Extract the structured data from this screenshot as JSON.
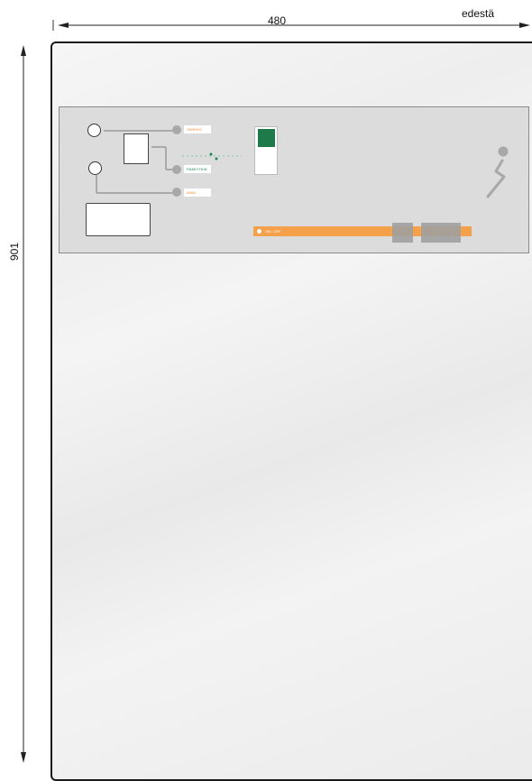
{
  "dimensions": {
    "width_label": "480",
    "height_label": "901",
    "view_label": "edestä"
  },
  "panel": {
    "lamp_labels": [
      "VERKKO",
      "PÄÄKYTKIN",
      "AVAU"
    ],
    "bar_label": "ON / OFF"
  },
  "colors": {
    "accent_orange": "#f5a04a",
    "label_orange": "#f28a2e",
    "label_green": "#1a8a5a",
    "module_green": "#1f7a4a",
    "panel_grey": "#dcdcdc"
  }
}
